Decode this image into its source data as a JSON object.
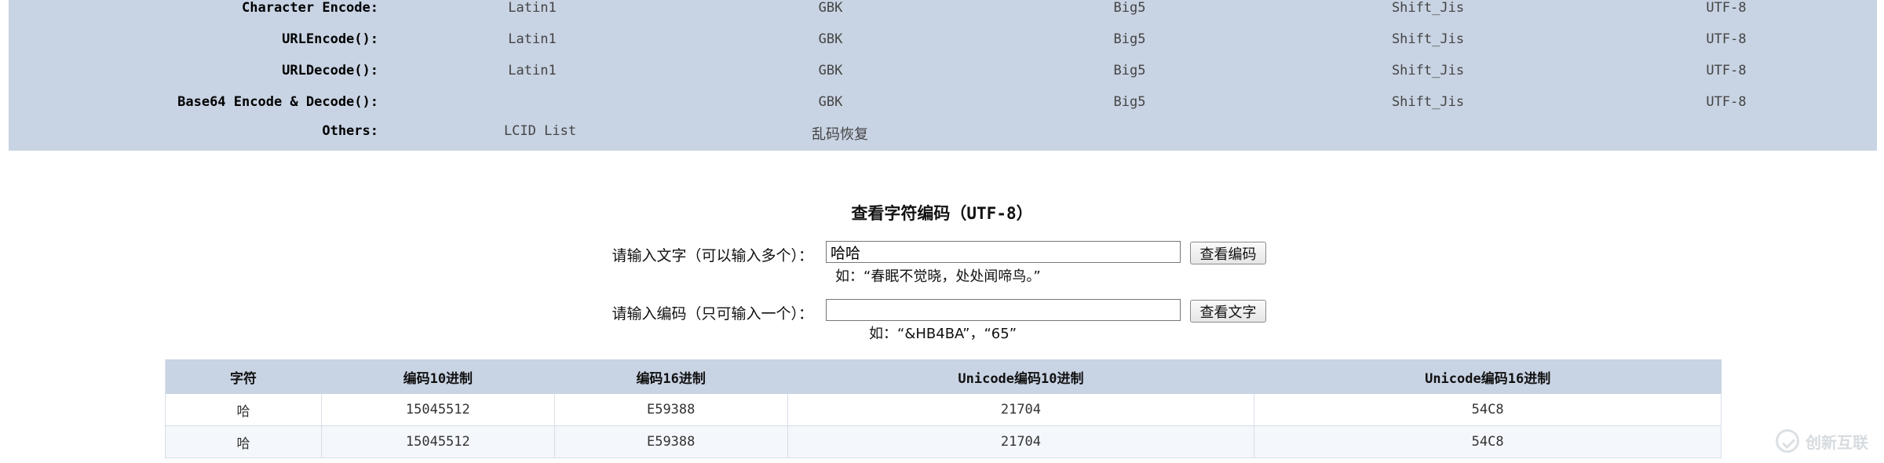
{
  "nav": {
    "rows": [
      {
        "label": "Character Encode:",
        "links": [
          "Latin1",
          "GBK",
          "Big5",
          "Shift_Jis",
          "UTF-8"
        ]
      },
      {
        "label": "URLEncode():",
        "links": [
          "Latin1",
          "GBK",
          "Big5",
          "Shift_Jis",
          "UTF-8"
        ]
      },
      {
        "label": "URLDecode():",
        "links": [
          "Latin1",
          "GBK",
          "Big5",
          "Shift_Jis",
          "UTF-8"
        ]
      },
      {
        "label": "Base64 Encode & Decode():",
        "links": [
          "GBK",
          "Big5",
          "Shift_Jis",
          "UTF-8"
        ]
      },
      {
        "label": "Others:",
        "links": [
          "LCID List",
          "乱码恢复"
        ]
      }
    ]
  },
  "tool": {
    "title": "查看字符编码（UTF-8）",
    "text_label": "请输入文字（可以输入多个）：",
    "text_value": "哈哈",
    "text_button": "查看编码",
    "text_hint": "如：“春眠不觉晓，处处闻啼鸟。”",
    "code_label": "请输入编码（只可输入一个）：",
    "code_value": "",
    "code_button": "查看文字",
    "code_hint": "如：“&HB4BA”，“65”"
  },
  "table": {
    "headers": [
      "字符",
      "编码10进制",
      "编码16进制",
      "Unicode编码10进制",
      "Unicode编码16进制"
    ],
    "rows": [
      [
        "哈",
        "15045512",
        "E59388",
        "21704",
        "54C8"
      ],
      [
        "哈",
        "15045512",
        "E59388",
        "21704",
        "54C8"
      ]
    ]
  },
  "watermark": {
    "text": "创新互联"
  },
  "colors": {
    "panel_bg": "#c8d3e3",
    "row_alt": "#f4f7fb"
  }
}
